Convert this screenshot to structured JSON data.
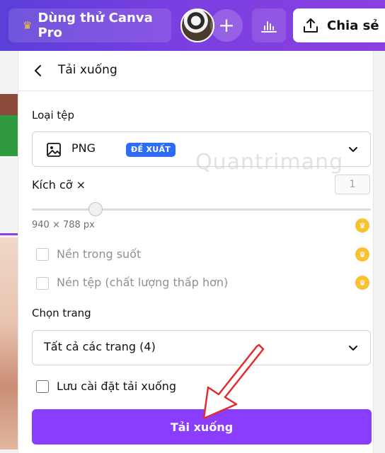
{
  "topbar": {
    "pro_label": "Dùng thử Canva Pro",
    "share_label": "Chia sẻ",
    "colors": {
      "gradient_start": "#5b3fd6",
      "gradient_end": "#8b3fe0",
      "crown": "#f7c231"
    }
  },
  "panel": {
    "title": "Tải xuống",
    "file_type": {
      "label": "Loại tệp",
      "value": "PNG",
      "badge": "ĐỀ XUẤT"
    },
    "size": {
      "label": "Kích cỡ ×",
      "value": "1",
      "dimensions": "940 × 788 px"
    },
    "options": {
      "transparent_bg": "Nền trong suốt",
      "compress": "Nén tệp (chất lượng thấp hơn)"
    },
    "pages": {
      "label": "Chọn trang",
      "value": "Tất cả các trang (4)"
    },
    "save_settings": "Lưu cài đặt tải xuống",
    "download_button": "Tải xuống"
  },
  "watermark": "Quantrimang",
  "icons": {
    "back": "chevron-left-icon",
    "file": "image-icon",
    "dropdown": "chevron-down-icon",
    "premium": "crown-icon",
    "share": "upload-icon",
    "stats": "bar-chart-icon",
    "add": "plus-icon"
  },
  "colors": {
    "primary_button": "#8b3dff",
    "badge": "#2d6df6",
    "annotation_arrow": "#e32b2b"
  }
}
